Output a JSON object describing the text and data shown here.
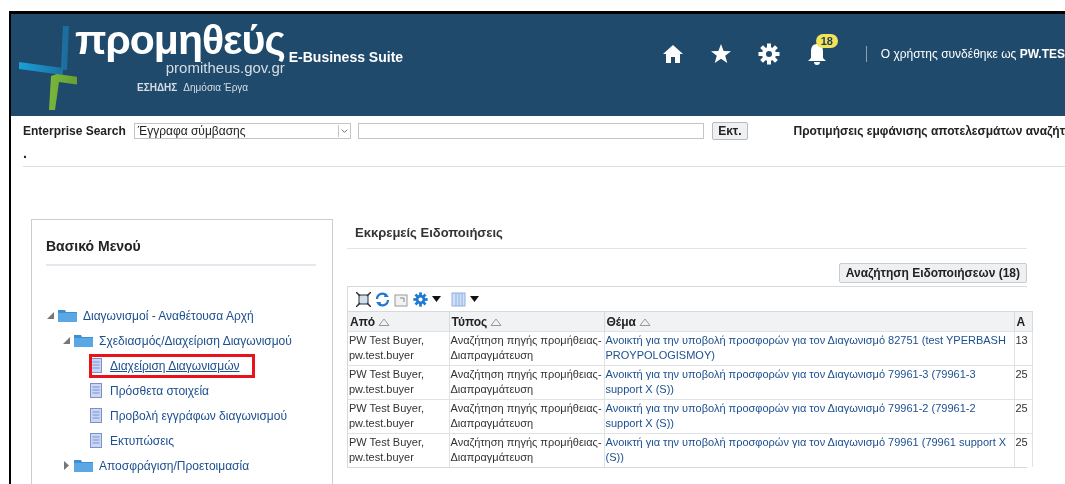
{
  "header": {
    "logo_word": "προμηθεύς",
    "logo_domain": "promitheus.gov.gr",
    "logo_tag": "ΕΣΗΔΗΣ",
    "logo_sub": "Δημόσια Έργα",
    "suite": "E-Business Suite",
    "notification_count": "18",
    "user_text": "Ο χρήστης συνδέθηκε ως **PW.TES**"
  },
  "search": {
    "label": "Enterprise Search",
    "category": "Έγγραφα σύμβασης",
    "button": "Εκτ.",
    "preferences": "Προτιμήσεις εμφάνισης αποτελεσμάτων αναζήτ"
  },
  "dot": ".",
  "menu": {
    "title": "Βασικό Μενού",
    "tree": [
      {
        "label": "Διαγωνισμοί - Αναθέτουσα Αρχή",
        "kind": "folder",
        "expanded": true,
        "children": [
          {
            "label": "Σχεδιασμός/Διαχείριση Διαγωνισμού",
            "kind": "folder",
            "expanded": true,
            "children": [
              {
                "label": "Διαχείριση Διαγωνισμών",
                "kind": "page",
                "highlighted": true
              },
              {
                "label": "Πρόσθετα στοιχεία",
                "kind": "page",
                "highlighted": false
              },
              {
                "label": "Προβολή εγγράφων διαγωνισμού",
                "kind": "page",
                "highlighted": false
              },
              {
                "label": "Εκτυπώσεις",
                "kind": "page",
                "highlighted": false
              }
            ]
          },
          {
            "label": "Αποσφράγιση/Προετοιμασία",
            "kind": "folder",
            "expanded": false
          }
        ]
      }
    ]
  },
  "notifications": {
    "title": "Εκκρεμείς Ειδοποιήσεις",
    "search_button": "Αναζήτηση Ειδοποιήσεων (18)",
    "table": {
      "columns": [
        "Από",
        "Τύπος",
        "Θέμα",
        "Α"
      ],
      "rows": [
        [
          "PW Test Buyer, pw.test.buyer",
          "Αναζήτηση πηγής προμήθειας-Διαπραγμάτευση",
          "Ανοικτή για την υποβολή προσφορών για τον Διαγωνισμό 82751 (test YPERBASH PROYPOLOGISMOY)",
          "13"
        ],
        [
          "PW Test Buyer, pw.test.buyer",
          "Αναζήτηση πηγής προμήθειας-Διαπραγμάτευση",
          "Ανοικτή για την υποβολή προσφορών για τον Διαγωνισμό 79961-3 (79961-3 support X (S))",
          "25"
        ],
        [
          "PW Test Buyer, pw.test.buyer",
          "Αναζήτηση πηγής προμήθειας-Διαπραγμάτευση",
          "Ανοικτή για την υποβολή προσφορών για τον Διαγωνισμό 79961-2 (79961-2 support X (S))",
          "25"
        ],
        [
          "PW Test Buyer, pw.test.buyer",
          "Αναζήτηση πηγής προμήθειας-Διαπραγμάτευση",
          "Ανοικτή για την υποβολή προσφορών για τον Διαγωνισμό 79961 (79961 support X (S))",
          "25"
        ]
      ]
    }
  }
}
